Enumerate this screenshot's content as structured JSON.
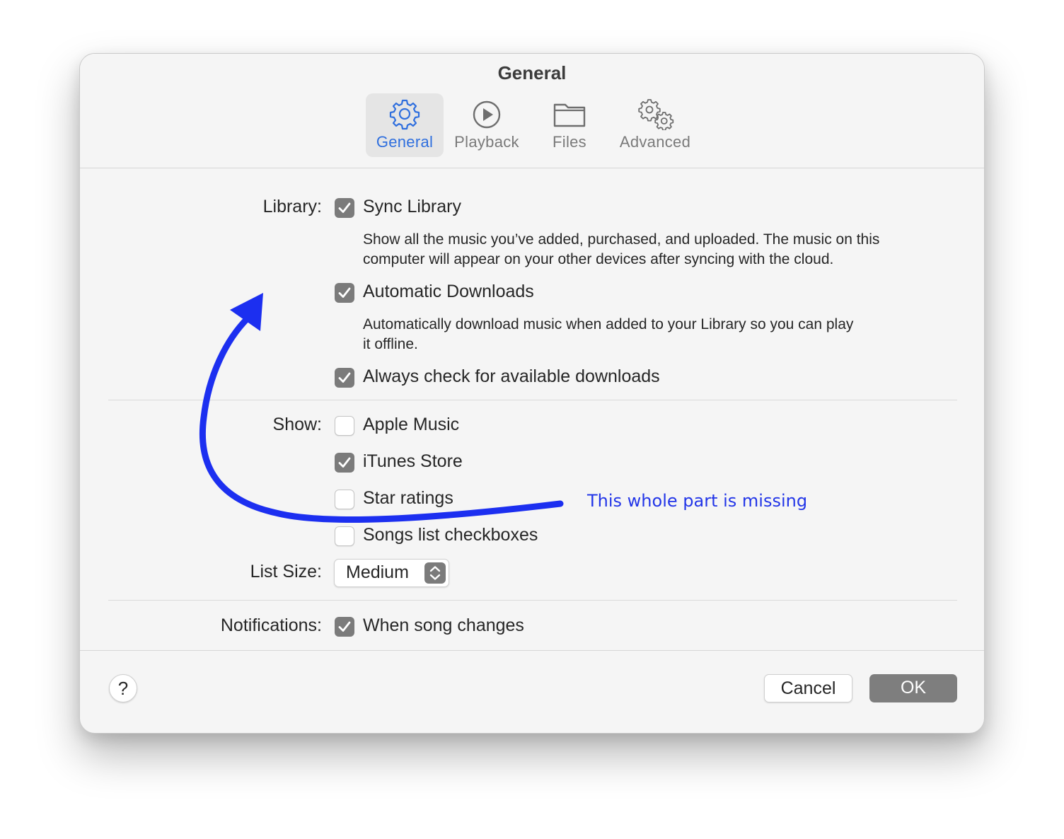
{
  "window": {
    "title": "General"
  },
  "toolbar": {
    "tabs": [
      {
        "label": "General",
        "icon": "gear-icon",
        "active": true
      },
      {
        "label": "Playback",
        "icon": "play-circle-icon",
        "active": false
      },
      {
        "label": "Files",
        "icon": "folder-icon",
        "active": false
      },
      {
        "label": "Advanced",
        "icon": "gears-icon",
        "active": false
      }
    ]
  },
  "library": {
    "label": "Library:",
    "sync": {
      "label": "Sync Library",
      "checked": true
    },
    "sync_desc_1": "Show all the music you’ve added, purchased, and uploaded. The music on this",
    "sync_desc_2": "computer will appear on your other devices after syncing with the cloud.",
    "auto": {
      "label": "Automatic Downloads",
      "checked": true
    },
    "auto_desc_1": "Automatically download music when added to your Library so you can play",
    "auto_desc_2": "it offline.",
    "always": {
      "label": "Always check for available downloads",
      "checked": true
    }
  },
  "show": {
    "label": "Show:",
    "items": [
      {
        "label": "Apple Music",
        "checked": false
      },
      {
        "label": "iTunes Store",
        "checked": true
      },
      {
        "label": "Star ratings",
        "checked": false
      },
      {
        "label": "Songs list checkboxes",
        "checked": false
      }
    ]
  },
  "list_size": {
    "label": "List Size:",
    "value": "Medium"
  },
  "notifications": {
    "label": "Notifications:",
    "option": {
      "label": "When song changes",
      "checked": true
    }
  },
  "footer": {
    "help": "?",
    "cancel": "Cancel",
    "ok": "OK"
  },
  "annotation": {
    "text": "This whole part is missing",
    "color": "#2336e8"
  },
  "colors": {
    "accent": "#2f6fde",
    "checkbox_on": "#7b7b7b",
    "ok_button": "#7e7e7e"
  }
}
